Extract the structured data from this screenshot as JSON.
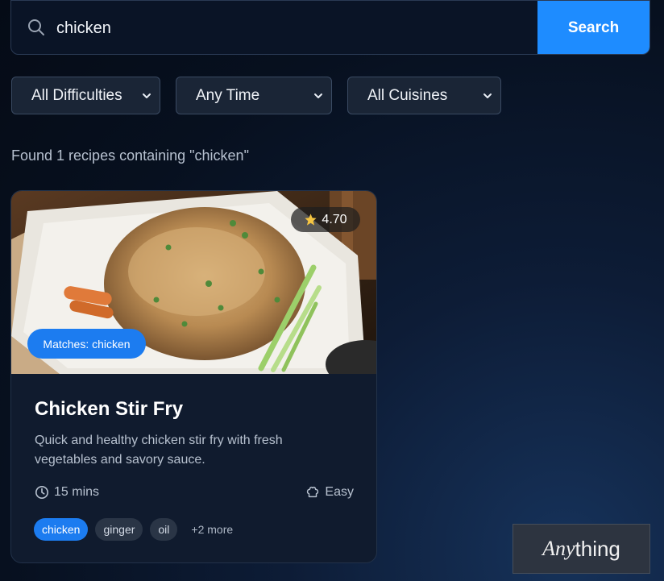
{
  "search": {
    "value": "chicken",
    "button_label": "Search"
  },
  "filters": {
    "difficulty": "All Difficulties",
    "time": "Any Time",
    "cuisine": "All Cuisines"
  },
  "results": {
    "summary": "Found 1 recipes containing \"chicken\""
  },
  "recipe": {
    "rating": "4.70",
    "match_label": "Matches: chicken",
    "title": "Chicken Stir Fry",
    "description": "Quick and healthy chicken stir fry with fresh vegetables and savory sauce.",
    "time": "15 mins",
    "difficulty": "Easy",
    "tags": [
      "chicken",
      "ginger",
      "oil"
    ],
    "more_tags": "+2 more"
  },
  "watermark": {
    "prefix": "Any",
    "suffix": "thing"
  },
  "colors": {
    "accent": "#1e8cff",
    "star": "#f5c542"
  },
  "icons": {
    "search": "search-icon",
    "star": "star-icon",
    "clock": "clock-icon",
    "difficulty": "chef-hat-icon",
    "chevron": "chevron-down-icon"
  }
}
